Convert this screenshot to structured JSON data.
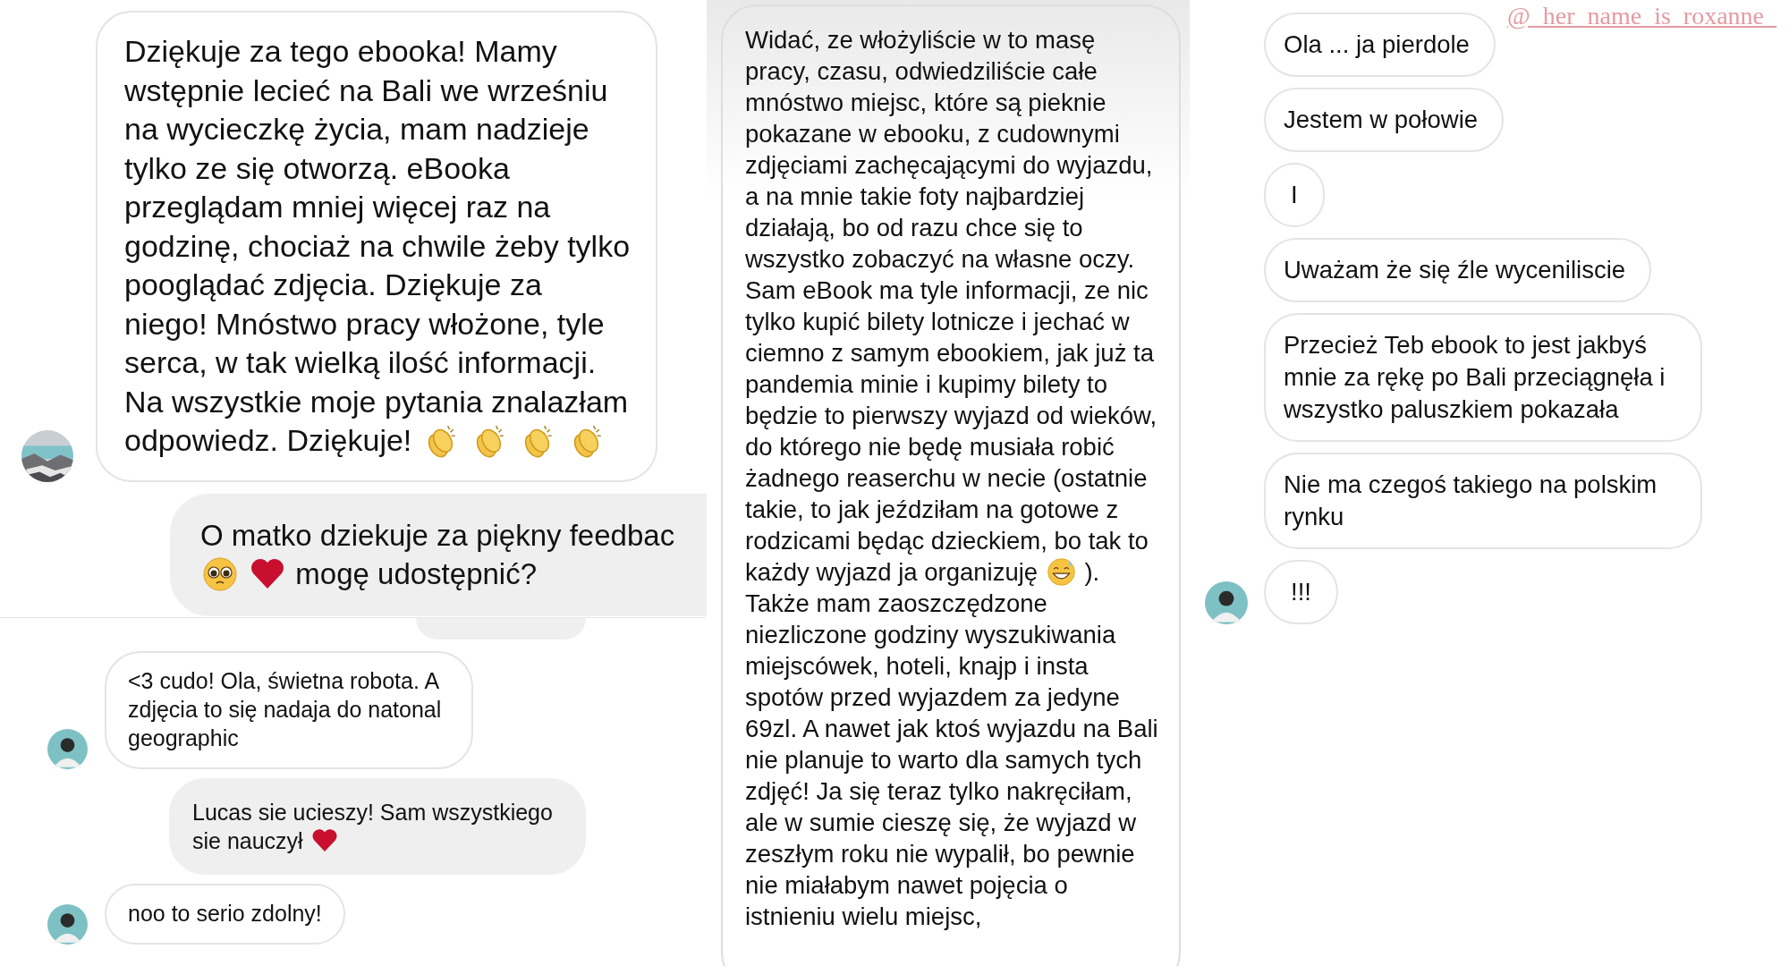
{
  "screenshots": [
    {
      "messages": [
        {
          "kind": "received",
          "parts": [
            {
              "kind": "text",
              "text": "Dziękuje za tego ebooka! Mamy wstępnie lecieć na Bali we wrześniu na wycieczkę życia, mam nadzieje tylko ze się otworzą. eBooka przeglądam mniej więcej raz na godzinę, chociaż na chwile żeby tylko pooglądać zdjęcia. Dziękuje za niego! Mnóstwo pracy włożone, tyle serca, w tak wielką ilość informacji. Na wszystkie moje pytania znalazłam odpowiedz. Dziękuje!"
            },
            {
              "kind": "clap"
            },
            {
              "kind": "clap"
            },
            {
              "kind": "clap"
            },
            {
              "kind": "clap"
            }
          ]
        },
        {
          "kind": "sent",
          "parts": [
            {
              "kind": "text",
              "text": "O matko dziekuje za piękny feedbac"
            },
            {
              "kind": "pleading"
            },
            {
              "kind": "heart"
            },
            {
              "kind": "text",
              "text": "mogę udostępnić?"
            }
          ]
        }
      ]
    },
    {
      "messages": [
        {
          "kind": "received",
          "avatar": {
            "kind": "person"
          },
          "parts": [
            {
              "kind": "text",
              "text": "<3 cudo! Ola, świetna robota. A zdjęcia to się nadaja do natonal geographic"
            }
          ]
        },
        {
          "kind": "sent",
          "parts": [
            {
              "kind": "text",
              "text": "Lucas sie ucieszy! Sam wszystkiego sie nauczył"
            },
            {
              "kind": "heart"
            }
          ]
        },
        {
          "kind": "received",
          "avatar": {
            "kind": "person"
          },
          "parts": [
            {
              "kind": "text",
              "text": "noo to serio zdolny!"
            }
          ]
        }
      ]
    },
    {
      "messages": [
        {
          "kind": "received",
          "parts": [
            {
              "kind": "text",
              "text": "Widać, ze włożyliście w to masę pracy, czasu, odwiedziliście całe mnóstwo miejsc, które są pieknie pokazane w ebooku, z cudownymi zdjęciami zachęcającymi do wyjazdu, a na mnie takie foty najbardziej działają, bo od razu chce się to wszystko zobaczyć na własne oczy. Sam eBook ma tyle informacji, ze nic tylko kupić bilety lotnicze i jechać w ciemno z samym ebookiem, jak już ta pandemia minie i kupimy bilety to będzie to pierwszy wyjazd od wieków, do którego nie będę musiała robić żadnego reaserchu w necie (ostatnie takie, to jak jeździłam na gotowe z rodzicami będąc dzieckiem, bo tak to każdy wyjazd ja organizuję"
            },
            {
              "kind": "grin-sweat"
            },
            {
              "kind": "text",
              "text": "). Także mam zaoszczędzone niezliczone godziny wyszukiwania miejscówek, hoteli, knajp i insta spotów przed wyjazdem za jedyne 69zl. A nawet jak ktoś wyjazdu na Bali nie planuje to warto dla samych tych zdjęć! Ja się teraz tylko nakręciłam, ale w sumie cieszę się, że wyjazd w zeszłym roku nie wypalił, bo pewnie nie miałabym nawet pojęcia o istnieniu wielu miejsc,"
            }
          ]
        }
      ]
    },
    {
      "mention": "@_her_name_is_roxanne_",
      "messages": [
        {
          "kind": "received",
          "parts": [
            {
              "kind": "text",
              "text": "Ola ... ja pierdole"
            }
          ]
        },
        {
          "kind": "received",
          "parts": [
            {
              "kind": "text",
              "text": "Jestem w połowie"
            }
          ]
        },
        {
          "kind": "received",
          "parts": [
            {
              "kind": "text",
              "text": "I"
            }
          ]
        },
        {
          "kind": "received",
          "parts": [
            {
              "kind": "text",
              "text": "Uważam że się źle wyceniliscie"
            }
          ]
        },
        {
          "kind": "received",
          "parts": [
            {
              "kind": "text",
              "text": "Przecież Teb ebook to jest jakbyś mnie za rękę po Bali przeciągnęła i wszystko paluszkiem pokazała"
            }
          ]
        },
        {
          "kind": "received",
          "parts": [
            {
              "kind": "text",
              "text": "Nie ma czegoś takiego na polskim rynku"
            }
          ]
        },
        {
          "kind": "received",
          "avatar": {
            "kind": "person"
          },
          "parts": [
            {
              "kind": "text",
              "text": "!!!"
            }
          ]
        }
      ]
    }
  ]
}
